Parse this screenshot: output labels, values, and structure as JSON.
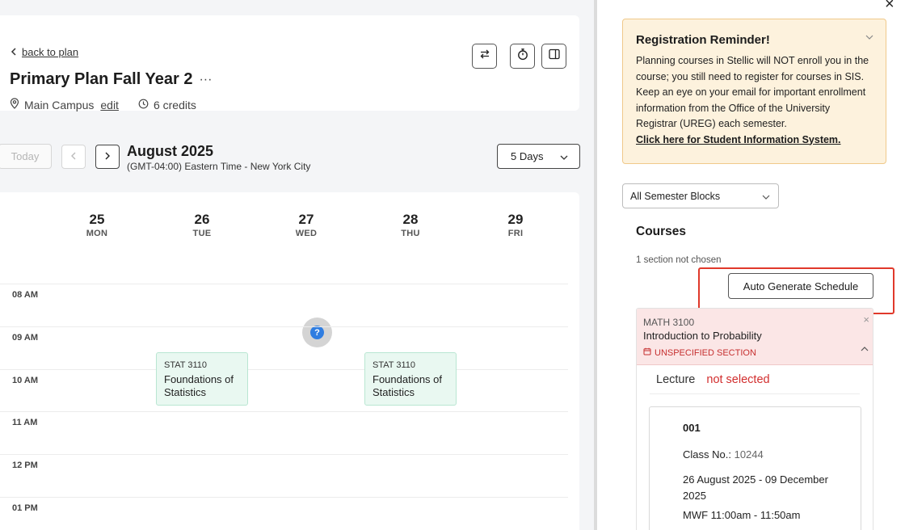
{
  "plan": {
    "back_label": "back to plan",
    "title": "Primary Plan Fall Year 2",
    "more": "···",
    "campus": "Main Campus",
    "edit_label": "edit",
    "credits": "6 credits"
  },
  "toolbar": {
    "today_label": "Today",
    "prev": "‹",
    "next": "›",
    "month": "August 2025",
    "timezone": "(GMT-04:00) Eastern Time - New York City",
    "view_select": "5 Days"
  },
  "calendar": {
    "days": [
      {
        "num": "25",
        "dow": "MON"
      },
      {
        "num": "26",
        "dow": "TUE"
      },
      {
        "num": "27",
        "dow": "WED"
      },
      {
        "num": "28",
        "dow": "THU"
      },
      {
        "num": "29",
        "dow": "FRI"
      }
    ],
    "hours": [
      "08 AM",
      "09 AM",
      "10 AM",
      "11 AM",
      "12 PM",
      "01 PM"
    ],
    "events": [
      {
        "day": "TUE",
        "code": "STAT 3110",
        "title": "Foundations of Statistics",
        "start": "09:35"
      },
      {
        "day": "THU",
        "code": "STAT 3110",
        "title": "Foundations of Statistics",
        "start": "09:35"
      }
    ],
    "help_icon": "?"
  },
  "sidebar": {
    "reminder": {
      "title": "Registration Reminder!",
      "body": "Planning courses in Stellic will NOT enroll you in the course; you still need to register for courses in SIS. Keep an eye on your email for important enrollment information from the Office of the University Registrar (UREG) each semester.",
      "link": "Click here for Student Information System."
    },
    "block_select": "All Semester Blocks",
    "courses_title": "Courses",
    "sections_note": "1 section not chosen",
    "auto_button": "Auto Generate Schedule",
    "course": {
      "code": "MATH 3100",
      "name": "Introduction to Probability",
      "warning": "UNSPECIFIED SECTION",
      "component": "Lecture",
      "component_status": "not selected",
      "section": {
        "number": "001",
        "class_no_label": "Class No.:",
        "class_no": "10244",
        "dates": "26 August 2025 - 09 December 2025",
        "time": "MWF 11:00am - 11:50am"
      }
    }
  },
  "colors": {
    "event_bg": "#e9f8f1",
    "warning": "#c62f2f",
    "reminder_bg": "#fdf2dd",
    "highlight": "#e0392b",
    "help_blue": "#2f7de1"
  }
}
